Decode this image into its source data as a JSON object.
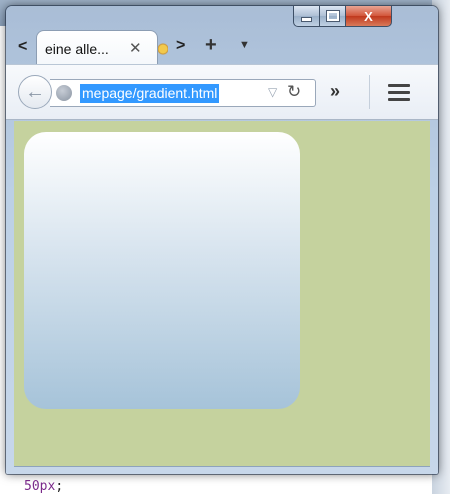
{
  "window": {
    "caption": {
      "minimize_icon": "minimize-icon",
      "maximize_icon": "maximize-icon",
      "close_label": "X"
    }
  },
  "tabstrip": {
    "scroll_left": "<",
    "tab_title": "eine alle...",
    "tab_close": "✕",
    "scroll_right": ">",
    "new_tab": "+",
    "tab_list": "▼"
  },
  "toolbar": {
    "back": "←",
    "url": "mepage/gradient.html",
    "dropmarker": "▽",
    "reload": "↻",
    "overflow": "»"
  },
  "content": {
    "background": "#c5d29e",
    "box_gradient": [
      "#ffffff",
      "#a6c3d9"
    ]
  },
  "below_window": {
    "code": "50px",
    "code_suffix": ";"
  }
}
